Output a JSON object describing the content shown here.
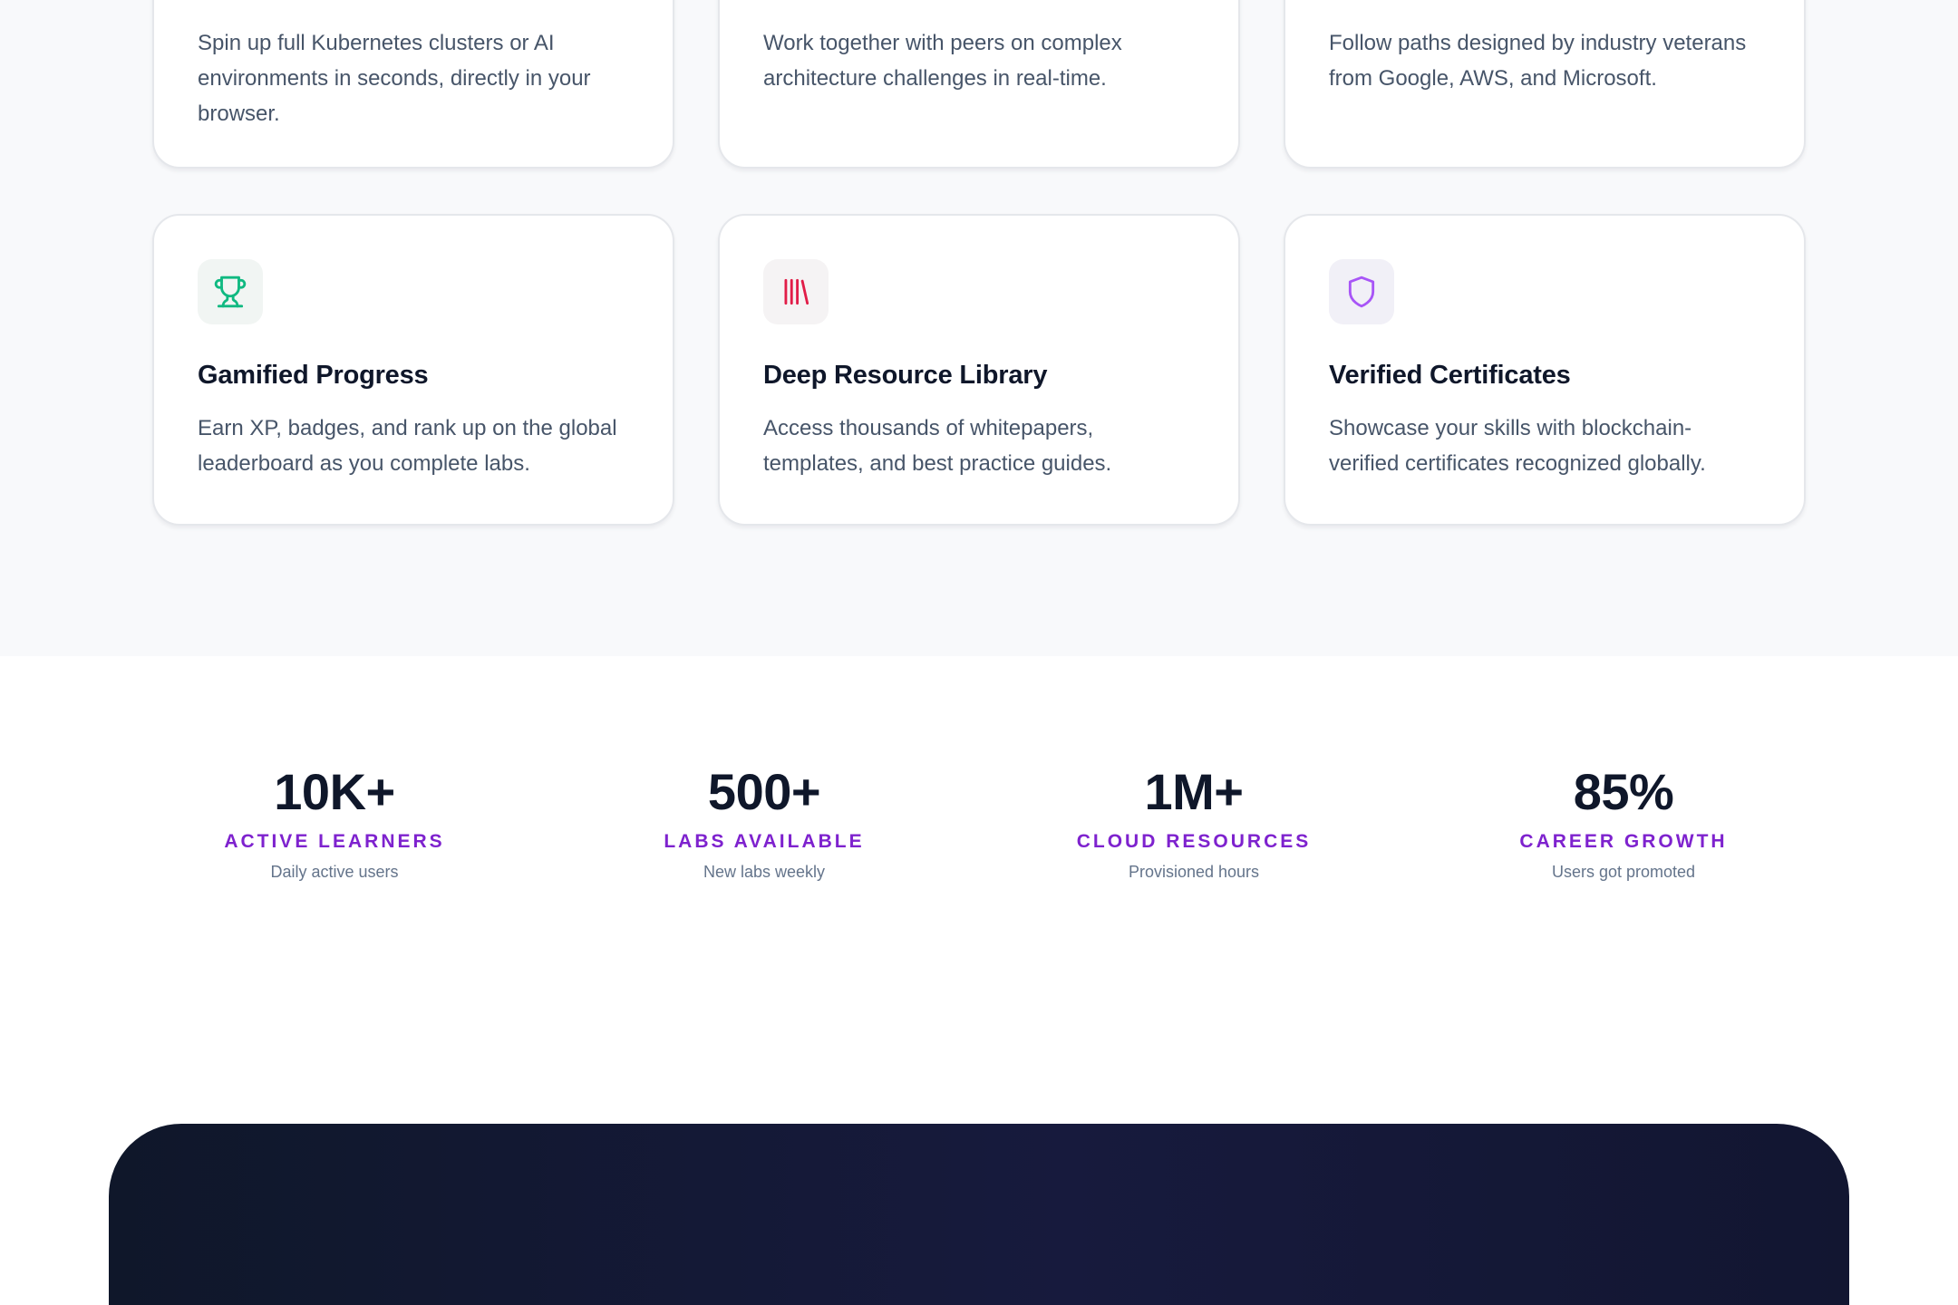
{
  "features": {
    "top_cards": [
      {
        "description": "Spin up full Kubernetes clusters or AI environments in seconds, directly in your browser."
      },
      {
        "description": "Work together with peers on complex architecture challenges in real-time."
      },
      {
        "description": "Follow paths designed by industry veterans from Google, AWS, and Microsoft."
      }
    ],
    "cards": [
      {
        "icon": "trophy-icon",
        "icon_color": "#10b981",
        "title": "Gamified Progress",
        "description": "Earn XP, badges, and rank up on the global leaderboard as you complete labs."
      },
      {
        "icon": "library-icon",
        "icon_color": "#e11d48",
        "title": "Deep Resource Library",
        "description": "Access thousands of whitepapers, templates, and best practice guides."
      },
      {
        "icon": "shield-icon",
        "icon_color": "#a855f7",
        "title": "Verified Certificates",
        "description": "Showcase your skills with blockchain-verified certificates recognized globally."
      }
    ]
  },
  "stats": [
    {
      "value": "10K+",
      "label": "ACTIVE LEARNERS",
      "sub": "Daily active users"
    },
    {
      "value": "500+",
      "label": "LABS AVAILABLE",
      "sub": "New labs weekly"
    },
    {
      "value": "1M+",
      "label": "CLOUD RESOURCES",
      "sub": "Provisioned hours"
    },
    {
      "value": "85%",
      "label": "CAREER GROWTH",
      "sub": "Users got promoted"
    }
  ],
  "colors": {
    "accent": "#7e22ce",
    "heading": "#0f172a",
    "body_text": "#475569",
    "cta_background": "#0f172a"
  }
}
